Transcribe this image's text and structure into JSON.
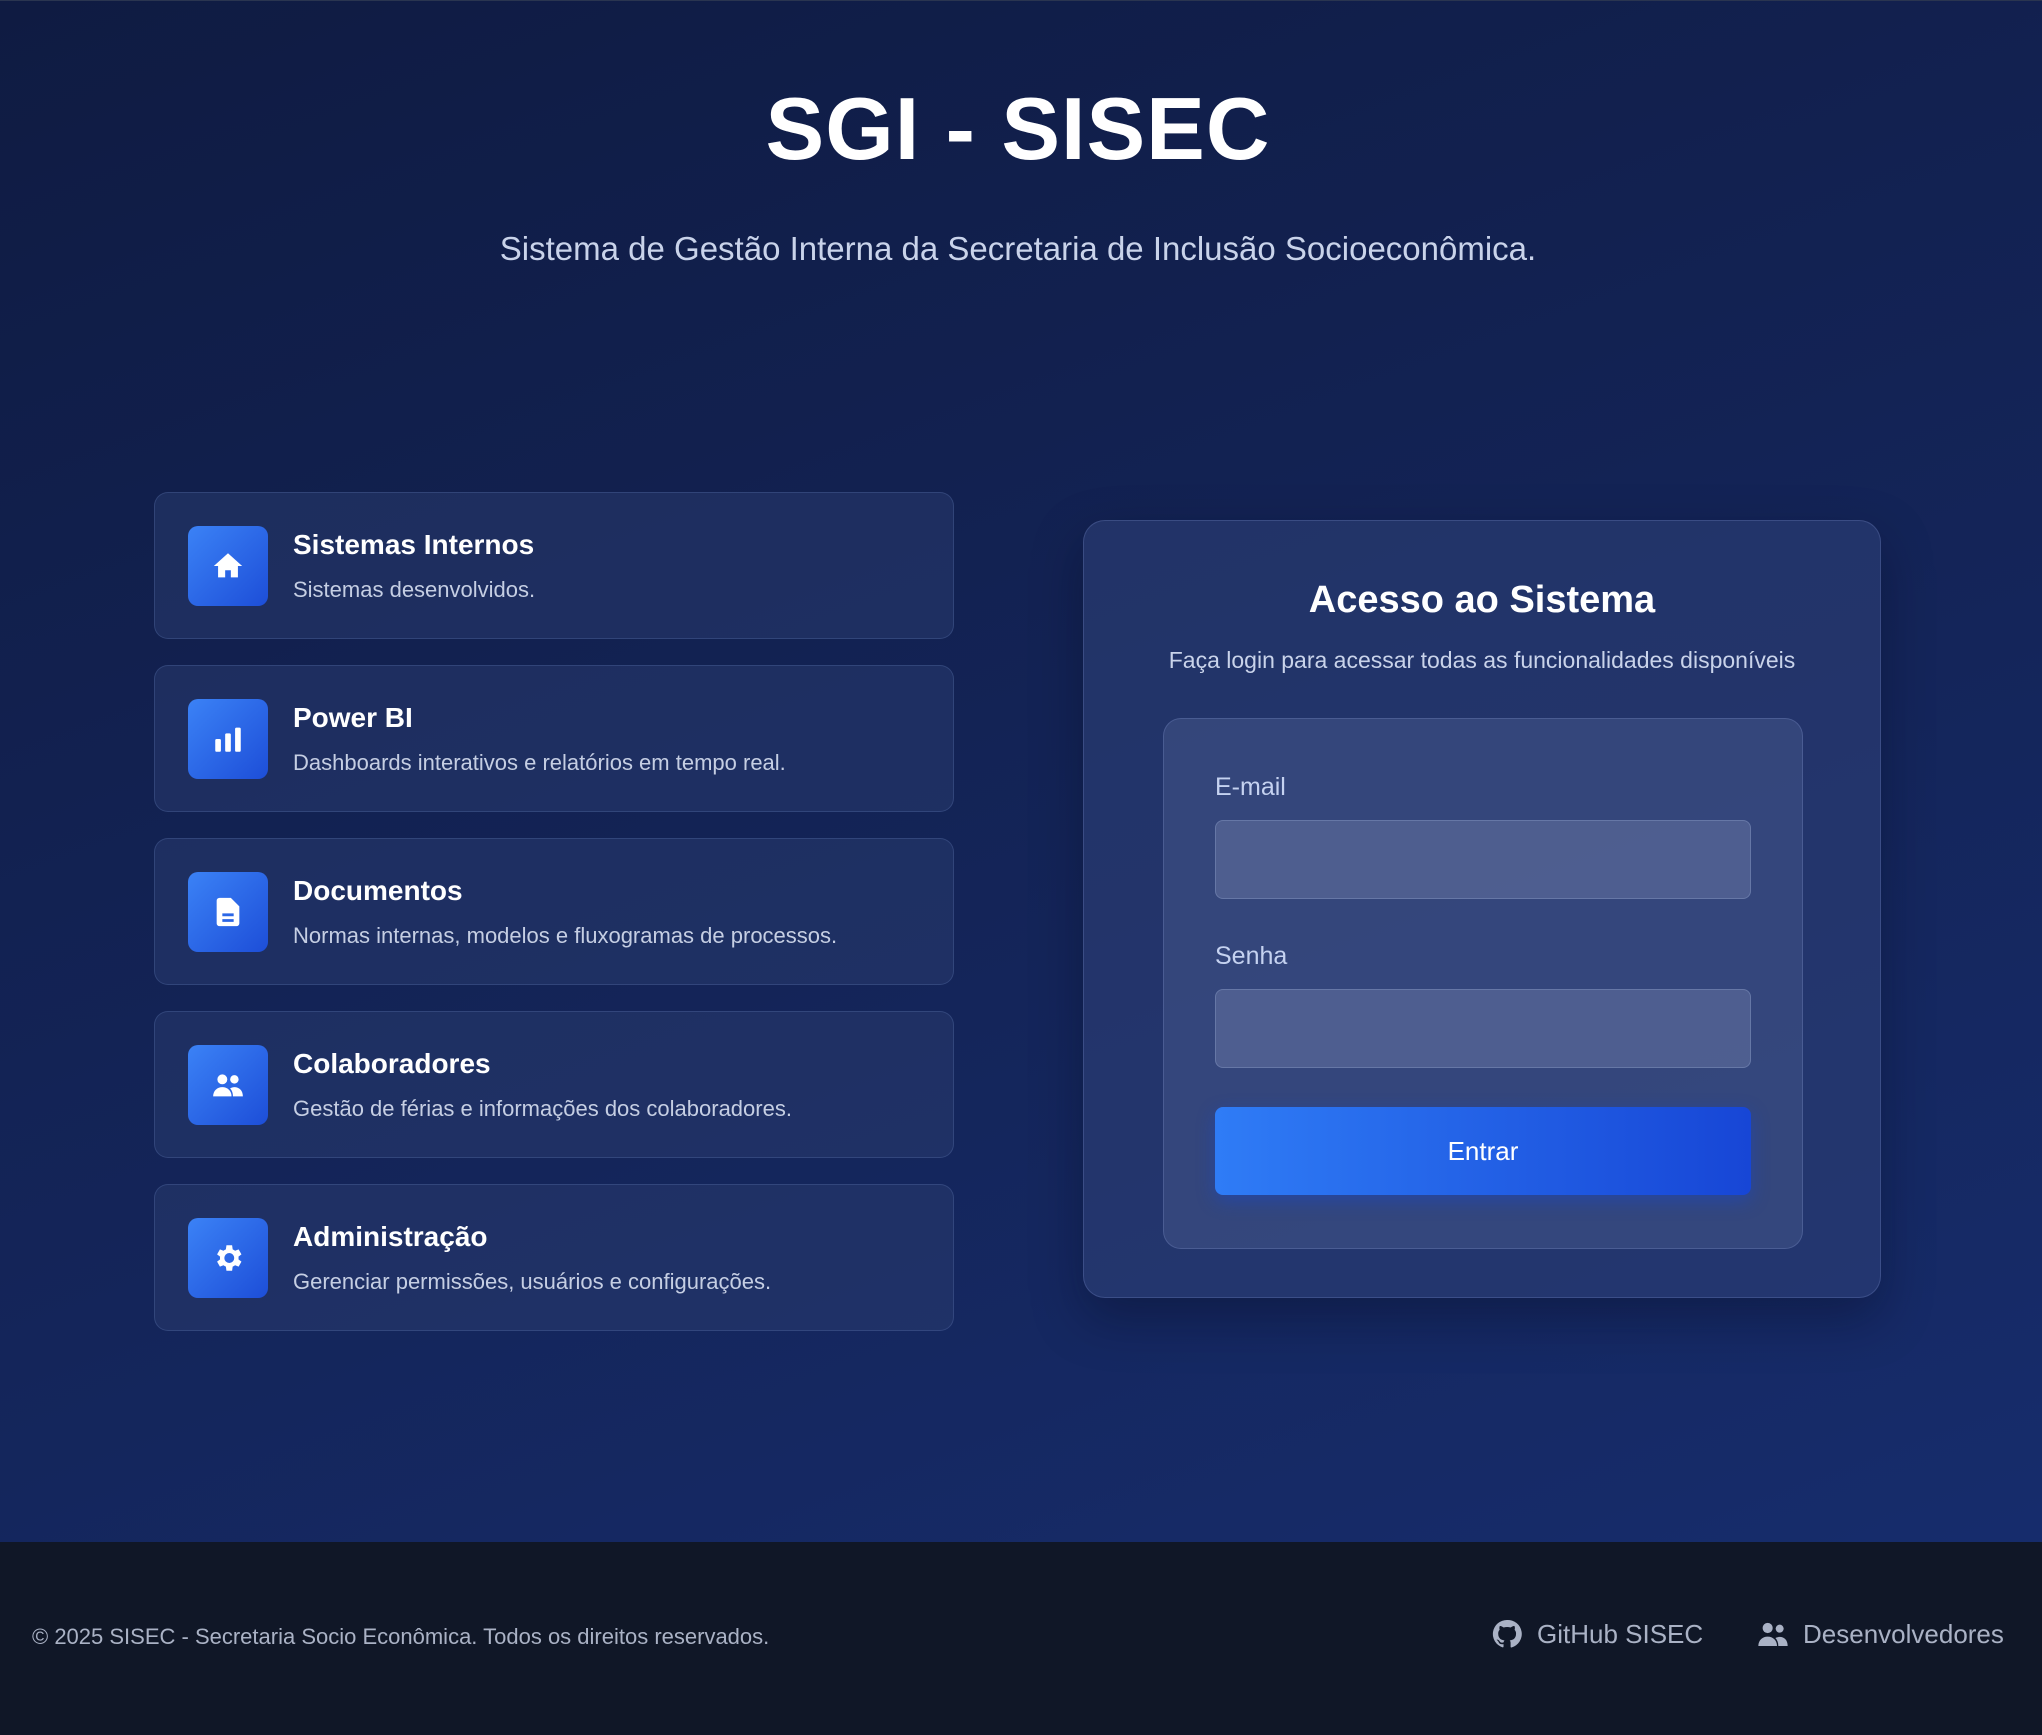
{
  "hero": {
    "title": "SGI - SISEC",
    "subtitle": "Sistema de Gestão Interna da Secretaria de Inclusão Socioeconômica."
  },
  "features": [
    {
      "icon": "home-icon",
      "title": "Sistemas Internos",
      "description": "Sistemas desenvolvidos."
    },
    {
      "icon": "bar-chart-icon",
      "title": "Power BI",
      "description": "Dashboards interativos e relatórios em tempo real."
    },
    {
      "icon": "document-icon",
      "title": "Documentos",
      "description": "Normas internas, modelos e fluxogramas de processos."
    },
    {
      "icon": "users-icon",
      "title": "Colaboradores",
      "description": "Gestão de férias e informações dos colaboradores."
    },
    {
      "icon": "gear-icon",
      "title": "Administração",
      "description": "Gerenciar permissões, usuários e configurações."
    }
  ],
  "login": {
    "title": "Acesso ao Sistema",
    "subtitle": "Faça login para acessar todas as funcionalidades disponíveis",
    "email_label": "E-mail",
    "email_value": "",
    "password_label": "Senha",
    "password_value": "",
    "submit_label": "Entrar"
  },
  "footer": {
    "copyright": "© 2025 SISEC - Secretaria Socio Econômica. Todos os direitos reservados.",
    "github_label": "GitHub SISEC",
    "github_icon": "github-icon",
    "devs_label": "Desenvolvedores",
    "devs_icon": "users-icon"
  },
  "colors": {
    "background": "#14255a",
    "accent": "#2f7cf6",
    "footer": "#101727"
  }
}
